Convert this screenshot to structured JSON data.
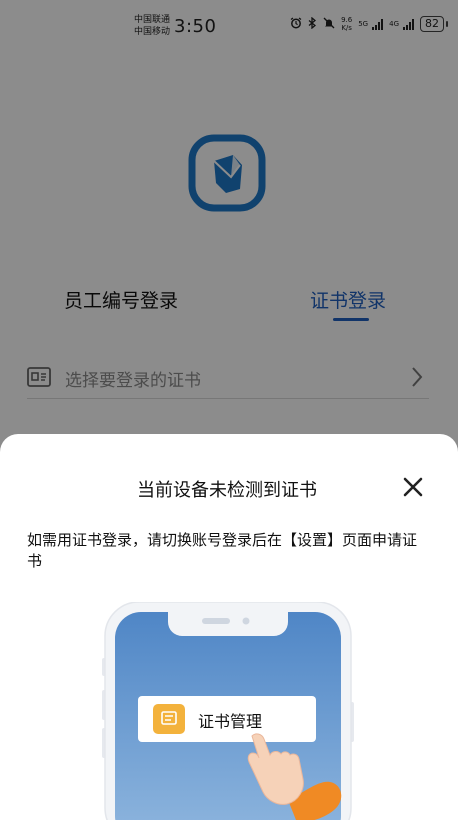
{
  "status_bar": {
    "carrier_1": "中国联通",
    "carrier_2": "中国移动",
    "time": "3:50",
    "net_speed_value": "9.6",
    "net_speed_unit": "K/s",
    "net_1": "5G",
    "net_2": "4G",
    "battery": "82"
  },
  "login": {
    "tab_employee": "员工编号登录",
    "tab_certificate": "证书登录",
    "cert_placeholder": "选择要登录的证书"
  },
  "sheet": {
    "title": "当前设备未检测到证书",
    "description": "如需用证书登录，请切换账号登录后在【设置】页面申请证书",
    "illustration_menu_label": "证书管理"
  },
  "colors": {
    "accent": "#1f5fbf",
    "logo_blue": "#1e78c8",
    "overlay": "rgba(0,0,0,0.45)"
  }
}
